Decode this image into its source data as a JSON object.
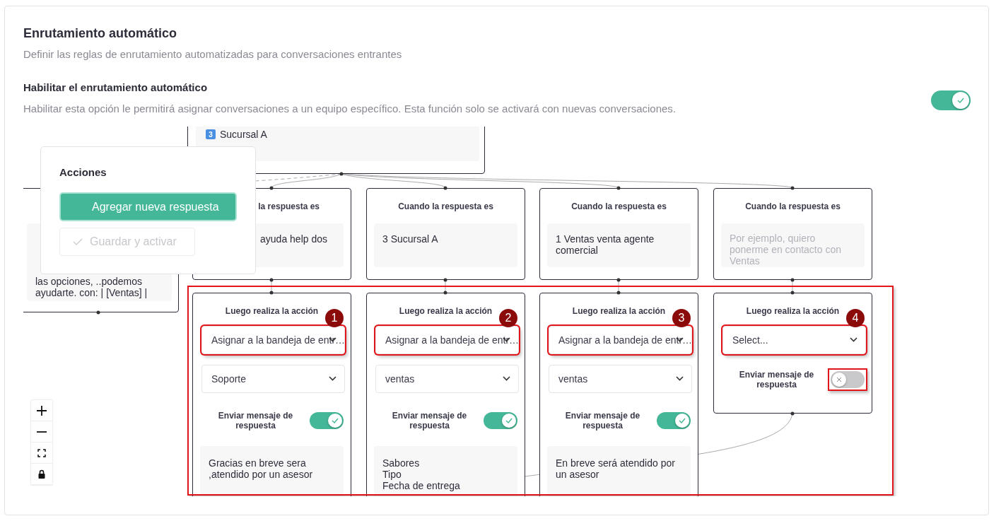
{
  "header": {
    "title": "Enrutamiento automático",
    "subtitle": "Definir las reglas de enrutamiento automatizadas para conversaciones entrantes"
  },
  "setting": {
    "label": "Habilitar el enrutamiento automático",
    "description": "Habilitar esta opción le permitirá asignar conversaciones a un equipo específico. Esta función solo se activará con nuevas conversaciones.",
    "on": true
  },
  "flow": {
    "top_node": {
      "option_number": "3",
      "option_label": "Sucursal A"
    },
    "left_node": {
      "message_lines": [
        "las opciones, ..podemos",
        "ayudarte. con: | [Ventas] |"
      ]
    },
    "conditions": [
      {
        "heading": "la respuesta es",
        "answer": "ayuda help dos",
        "partially_hidden": true
      },
      {
        "heading": "Cuando la respuesta es",
        "answer": "3 Sucursal A",
        "partially_hidden": false
      },
      {
        "heading": "Cuando la respuesta es",
        "answer": "1 Ventas venta agente comercial",
        "partially_hidden": false
      },
      {
        "heading": "Cuando la respuesta es",
        "placeholder": "Por ejemplo, quiero ponerme en contacto con Ventas",
        "partially_hidden": false
      }
    ],
    "actions": [
      {
        "heading": "Luego realiza la acción",
        "annotation_number": "1",
        "action_select": {
          "value": "Asignar a la bandeja de entr…",
          "highlighted": true
        },
        "inbox_select": {
          "value": "Soporte"
        },
        "reply_label": "Enviar mensaje de respuesta",
        "reply_on": true,
        "toggle_highlighted": false,
        "reply_message": [
          "Gracias en breve sera",
          ",atendido por un asesor"
        ]
      },
      {
        "heading": "Luego realiza la acción",
        "annotation_number": "2",
        "action_select": {
          "value": "Asignar a la bandeja de entr…",
          "highlighted": true
        },
        "inbox_select": {
          "value": "ventas"
        },
        "reply_label": "Enviar mensaje de respuesta",
        "reply_on": true,
        "toggle_highlighted": false,
        "reply_message": [
          "Sabores",
          "Tipo",
          "Fecha de entrega"
        ]
      },
      {
        "heading": "Luego realiza la acción",
        "annotation_number": "3",
        "action_select": {
          "value": "Asignar a la bandeja de entr…",
          "highlighted": true
        },
        "inbox_select": {
          "value": "ventas"
        },
        "reply_label": "Enviar mensaje de respuesta",
        "reply_on": true,
        "toggle_highlighted": false,
        "reply_message": [
          "En breve será atendido por",
          "un asesor"
        ]
      },
      {
        "heading": "Luego realiza la acción",
        "annotation_number": "4",
        "action_select": {
          "placeholder": "Select...",
          "highlighted": true
        },
        "reply_label": "Enviar mensaje de respuesta",
        "reply_on": false,
        "toggle_highlighted": true
      }
    ],
    "popup": {
      "title": "Acciones",
      "primary_button": "Agregar nueva respuesta",
      "secondary_button": {
        "label": "Guardar y activar",
        "disabled": true
      }
    }
  }
}
